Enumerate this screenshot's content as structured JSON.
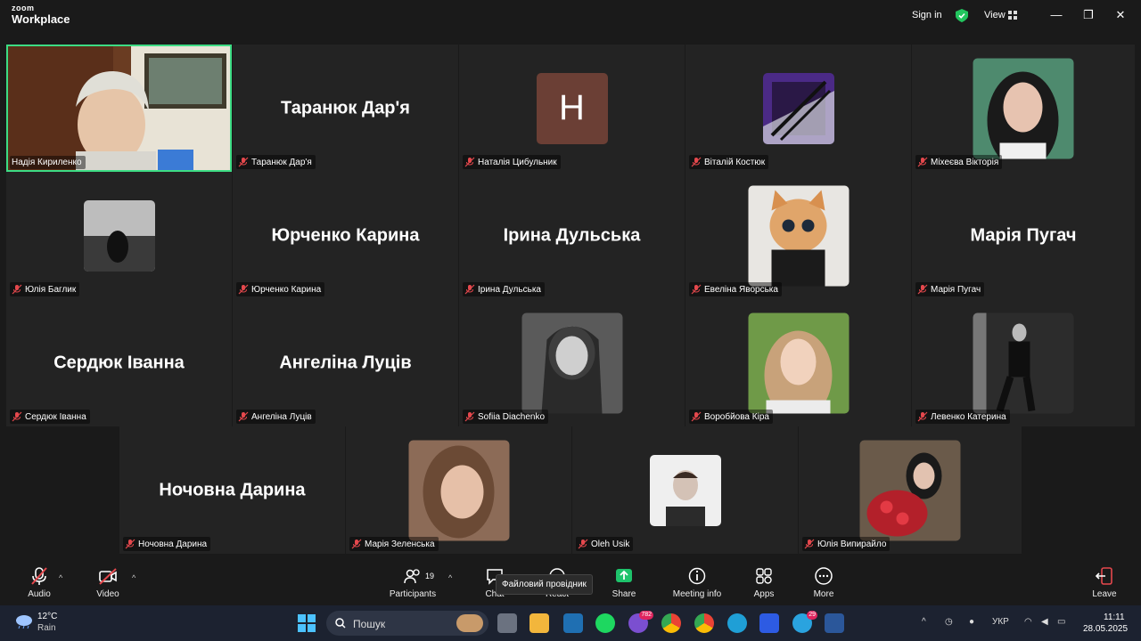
{
  "app": {
    "brand_small": "zoom",
    "brand_big": "Workplace",
    "sign_in": "Sign in",
    "view": "View"
  },
  "active_speaker": "Надія Кириленко",
  "participants": [
    {
      "name": "Надія Кириленко",
      "display": "video",
      "active": true
    },
    {
      "name": "Таранюк Дар'я",
      "display": "name"
    },
    {
      "name": "Наталія Цибульник",
      "display": "letter",
      "letter": "Н",
      "color": "#6b3f35"
    },
    {
      "name": "Віталій Костюк",
      "display": "photo"
    },
    {
      "name": "Міхеєва Вікторія",
      "display": "photo"
    },
    {
      "name": "Юлія Баглик",
      "display": "photo"
    },
    {
      "name": "Юрченко Карина",
      "display": "name"
    },
    {
      "name": "Ірина Дульська",
      "display": "name"
    },
    {
      "name": "Евеліна Яворська",
      "display": "photo"
    },
    {
      "name": "Марія Пугач",
      "display": "name"
    },
    {
      "name": "Сердюк Іванна",
      "display": "name"
    },
    {
      "name": "Ангеліна Луців",
      "display": "name"
    },
    {
      "name": "Sofiia Diachenko",
      "display": "photo"
    },
    {
      "name": "Воробйова Кіра",
      "display": "photo"
    },
    {
      "name": "Левенко Катерина",
      "display": "photo"
    },
    {
      "name": "Ночовна Дарина",
      "display": "name"
    },
    {
      "name": "Марія Зеленська",
      "display": "photo"
    },
    {
      "name": "Oleh Usik",
      "display": "photo"
    },
    {
      "name": "Юлія Випирайло",
      "display": "photo"
    }
  ],
  "toolbar": {
    "audio": "Audio",
    "video": "Video",
    "participants": "Participants",
    "participants_count": "19",
    "chat": "Chat",
    "react": "React",
    "share": "Share",
    "meeting_info": "Meeting info",
    "apps": "Apps",
    "more": "More",
    "leave": "Leave"
  },
  "tooltip": "Файловий провідник",
  "taskbar": {
    "temp": "12°C",
    "weather": "Rain",
    "search_placeholder": "Пошук",
    "viber_badge": "782",
    "telegram_badge": "29",
    "lang": "УКР",
    "time": "11:11",
    "date": "28.05.2025"
  },
  "colors": {
    "accent_green": "#3ddc84",
    "leave_red": "#e5484d",
    "share_green": "#1ec36b",
    "tile_bg": "#232323"
  }
}
